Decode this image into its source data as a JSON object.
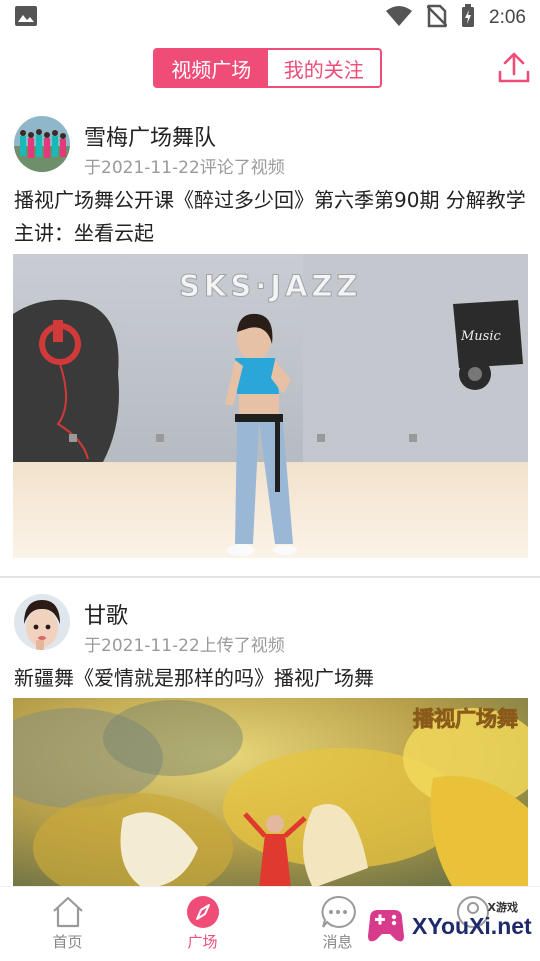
{
  "status_bar": {
    "time": "2:06"
  },
  "header": {
    "tabs": [
      {
        "label": "视频广场",
        "active": true
      },
      {
        "label": "我的关注",
        "active": false
      }
    ]
  },
  "posts": [
    {
      "user": "雪梅广场舞队",
      "meta": "于2021-11-22评论了视频",
      "title": "播视广场舞公开课《醉过多少回》第六季第90期 分解教学 主讲：坐看云起",
      "image_sign": "SKS·JAZZ",
      "image_poster": "Music"
    },
    {
      "user": "甘歌",
      "meta": "于2021-11-22上传了视频",
      "title": "新疆舞《爱情就是那样的吗》播视广场舞",
      "image_watermark": "播视广场舞"
    }
  ],
  "bottom_nav": [
    {
      "label": "首页",
      "icon": "home-icon",
      "active": false
    },
    {
      "label": "广场",
      "icon": "compass-icon",
      "active": true
    },
    {
      "label": "消息",
      "icon": "message-icon",
      "active": false
    },
    {
      "label": "",
      "icon": "profile-icon",
      "active": false
    }
  ],
  "watermark": {
    "brand": "XYouXi.net",
    "tag": "X游戏"
  },
  "colors": {
    "accent": "#ef4d78"
  }
}
